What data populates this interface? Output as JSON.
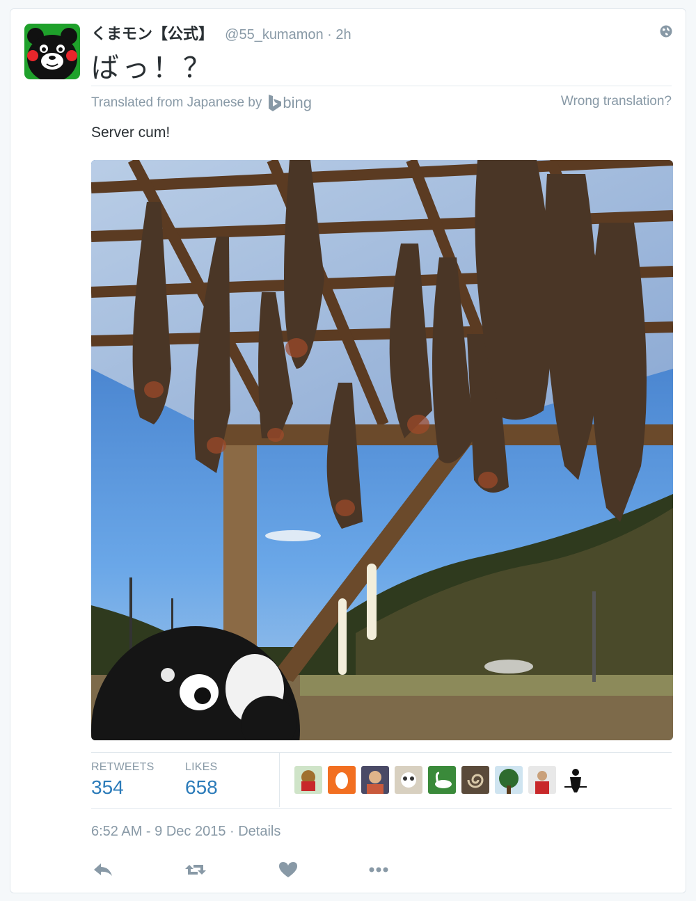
{
  "author": {
    "name": "くまモン【公式】",
    "handle": "@55_kumamon",
    "time_ago": "2h"
  },
  "tweet": {
    "text": "ばっ！？",
    "translated_from": "Translated from Japanese by",
    "translator": "bing",
    "wrong_translation": "Wrong translation?",
    "translation": "Server cum!"
  },
  "stats": {
    "retweets_label": "RETWEETS",
    "retweets": "354",
    "likes_label": "LIKES",
    "likes": "658"
  },
  "timestamp": "6:52 AM - 9 Dec 2015 · Details",
  "likers": [
    "teddy-bear-avatar",
    "orange-egg-avatar",
    "person-avatar",
    "cat-avatar",
    "swan-avatar",
    "spiral-avatar",
    "tree-avatar",
    "sports-avatar",
    "silhouette-avatar"
  ],
  "colors": {
    "accent": "#2b7bb9",
    "muted": "#8899a6",
    "border": "#e1e8ed"
  }
}
